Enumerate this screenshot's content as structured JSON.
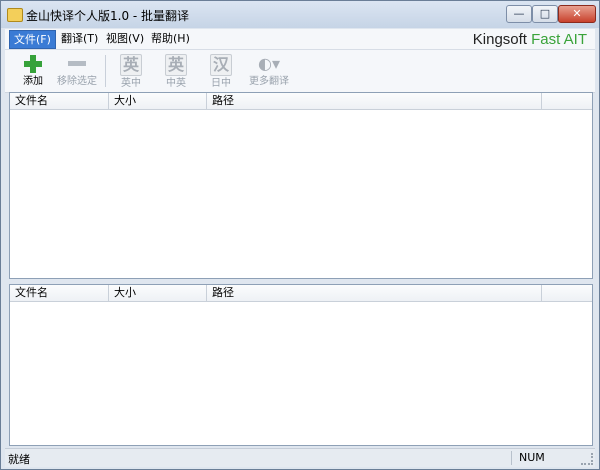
{
  "window": {
    "title": "金山快译个人版1.0 - 批量翻译",
    "controls": {
      "minimize": "—",
      "maximize": "□",
      "close": "✕"
    }
  },
  "menubar": {
    "items": [
      {
        "label": "文件(F)",
        "active": true
      },
      {
        "label": "翻译(T)"
      },
      {
        "label": "视图(V)"
      },
      {
        "label": "帮助(H)"
      }
    ],
    "brand_main": "Kingsoft ",
    "brand_accent": "Fast AIT"
  },
  "toolbar": {
    "items": [
      {
        "label": "添加",
        "icon": "plus-icon",
        "enabled": true
      },
      {
        "label": "移除选定",
        "icon": "minus-icon",
        "enabled": false
      },
      {
        "label": "英中",
        "icon": "en-zh-icon",
        "glyph": "英",
        "enabled": false
      },
      {
        "label": "中英",
        "icon": "zh-en-icon",
        "glyph": "英",
        "enabled": false
      },
      {
        "label": "日中",
        "icon": "ja-zh-icon",
        "glyph": "汉",
        "enabled": false
      },
      {
        "label": "更多翻译",
        "icon": "more-translate-icon",
        "glyph": "◐▾",
        "enabled": false
      }
    ]
  },
  "top_table": {
    "columns": [
      "文件名",
      "大小",
      "路径",
      ""
    ]
  },
  "bottom_table": {
    "columns": [
      "文件名",
      "大小",
      "路径",
      ""
    ]
  },
  "statusbar": {
    "left": "就绪",
    "right": "NUM"
  },
  "colors": {
    "accent": "#3a7bd5",
    "brand_green": "#3aa33a",
    "add_green": "#36a23a"
  }
}
